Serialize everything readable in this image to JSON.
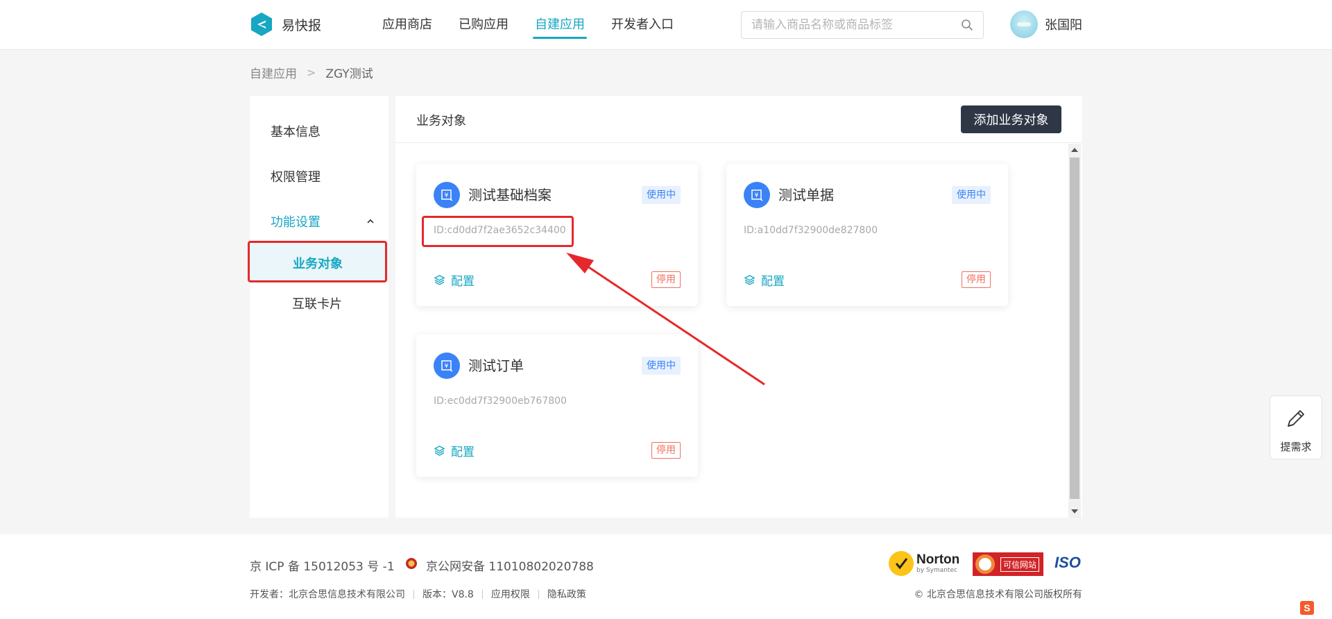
{
  "header": {
    "logo_text": "易快报",
    "nav": [
      "应用商店",
      "已购应用",
      "自建应用",
      "开发者入口"
    ],
    "active_nav": "自建应用",
    "search_placeholder": "请输入商品名称或商品标签",
    "user_name": "张国阳"
  },
  "breadcrumb": {
    "parent": "自建应用",
    "separator": ">",
    "current": "ZGY测试"
  },
  "sidebar": {
    "items": [
      "基本信息",
      "权限管理"
    ],
    "group_label": "功能设置",
    "sub_items": [
      "业务对象",
      "互联卡片"
    ],
    "active_sub": "业务对象"
  },
  "main": {
    "title": "业务对象",
    "add_button": "添加业务对象",
    "cards": [
      {
        "title": "测试基础档案",
        "status": "使用中",
        "id": "ID:cd0dd7f2ae3652c34400",
        "config": "配置",
        "action": "停用"
      },
      {
        "title": "测试单据",
        "status": "使用中",
        "id": "ID:a10dd7f32900de827800",
        "config": "配置",
        "action": "停用"
      },
      {
        "title": "测试订单",
        "status": "使用中",
        "id": "ID:ec0dd7f32900eb767800",
        "config": "配置",
        "action": "停用"
      }
    ]
  },
  "float_button": {
    "label": "提需求"
  },
  "footer": {
    "icp": "京 ICP 备 15012053 号 -1",
    "police": "京公网安备 11010802020788",
    "links": [
      "开发者：北京合思信息技术有限公司",
      "版本：V8.8",
      "应用权限",
      "隐私政策"
    ],
    "copyright": "© 北京合思信息技术有限公司版权所有",
    "badges": {
      "norton": "Norton",
      "norton_sub": "by Symantec",
      "trust": "可信网站",
      "iso": "ISO"
    }
  },
  "colors": {
    "accent": "#17a6c3",
    "dark_button": "#2f3747",
    "card_icon": "#3a82f7",
    "status_using": "#3a82f7",
    "stop": "#f0705e",
    "annotation": "#e5282b"
  },
  "icons": {
    "logo": "e-logo-icon",
    "search": "search-icon",
    "chevron": "chevron-up-icon",
    "card": "finance-doc-icon",
    "config": "layers-icon",
    "float": "pencil-icon"
  }
}
